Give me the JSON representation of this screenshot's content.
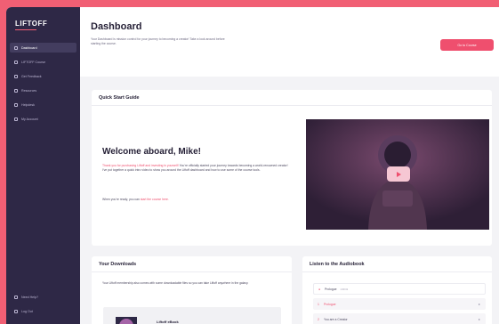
{
  "brand": {
    "logo_text": "LIFTOFF"
  },
  "sidebar": {
    "items": [
      {
        "label": "Dashboard"
      },
      {
        "label": "LIFTOFF Course"
      },
      {
        "label": "Get Feedback"
      },
      {
        "label": "Resources"
      },
      {
        "label": "Helpdesk"
      },
      {
        "label": "My Account"
      }
    ],
    "bottom_items": [
      {
        "label": "Need Help?"
      },
      {
        "label": "Log Out"
      }
    ]
  },
  "header": {
    "title": "Dashboard",
    "description": "Your Dashboard is mission control for your journey to becoming a creator! Take a look around before starting the course.",
    "cta_label": "Go to Course"
  },
  "quick_start": {
    "title": "Quick Start Guide",
    "welcome": "Welcome aboard, Mike!",
    "body_highlight": "Thank you for purchasing Liftoff and investing in yourself!",
    "body_rest": " You're officially started your journey towards becoming a world-renowned creator! I've put together a quick intro video to show you around the Liftoff dashboard and how to use some of the course tools.",
    "tail_text": "When you're ready, you can ",
    "tail_link": "start the course here."
  },
  "downloads": {
    "title": "Your Downloads",
    "body": "Your Liftoff membership also comes with some downloadable files so you can take Liftoff anywhere in the galaxy.",
    "ebook_label": "Liftoff eBook"
  },
  "audiobook": {
    "title": "Listen to the Audiobook",
    "tracks": [
      {
        "title": "Prologue",
        "sub": "1:00:31",
        "num": "●",
        "chevron": ""
      },
      {
        "title": "Prologue",
        "num": "1",
        "chevron": "▸"
      },
      {
        "title": "You are a Creator",
        "num": "2",
        "chevron": "▸"
      }
    ]
  },
  "colors": {
    "accent": "#ef4f6e",
    "sidebar": "#2e2846",
    "background": "#f15f74"
  },
  "icons": {
    "play": "play-icon"
  }
}
